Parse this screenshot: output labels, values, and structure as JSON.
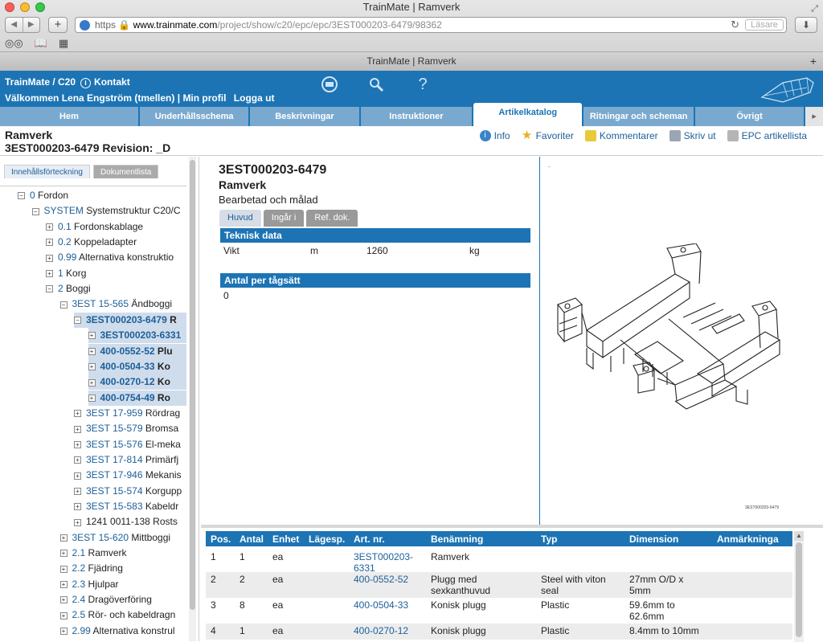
{
  "browser": {
    "title": "TrainMate | Ramverk",
    "url_scheme": "https",
    "url_host": "www.trainmate.com",
    "url_path": "/project/show/c20/epc/epc/3EST000203-6479/98362",
    "reader_label": "Läsare",
    "tab_title": "TrainMate | Ramverk"
  },
  "app": {
    "brand": "TrainMate / C20",
    "contact": "Kontakt",
    "welcome": "Välkommen Lena Engström (tmellen)",
    "profile": "Min profil",
    "logout": "Logga ut",
    "sep": "|"
  },
  "nav_tabs": [
    "Hem",
    "Underhållsschema",
    "Beskrivningar",
    "Instruktioner",
    "Artikelkatalog",
    "Ritningar och scheman",
    "Övrigt"
  ],
  "page": {
    "title": "Ramverk",
    "subtitle": "3EST000203-6479 Revision: _D",
    "actions": [
      "Info",
      "Favoriter",
      "Kommentarer",
      "Skriv ut",
      "EPC artikellista"
    ]
  },
  "left": {
    "tabs": [
      "Innehållsförteckning",
      "Dokumentlista"
    ],
    "tree": [
      {
        "code": "0",
        "name": "Fordon",
        "level": 0,
        "sign": "−"
      },
      {
        "code": "SYSTEM",
        "name": "Systemstruktur C20/C",
        "level": 1,
        "sign": "−"
      },
      {
        "code": "0.1",
        "name": "Fordonskablage",
        "level": 2,
        "sign": "+"
      },
      {
        "code": "0.2",
        "name": "Koppeladapter",
        "level": 2,
        "sign": "+"
      },
      {
        "code": "0.99",
        "name": "Alternativa konstruktio",
        "level": 2,
        "sign": "+"
      },
      {
        "code": "1",
        "name": "Korg",
        "level": 2,
        "sign": "+"
      },
      {
        "code": "2",
        "name": "Boggi",
        "level": 2,
        "sign": "−"
      },
      {
        "code": "3EST 15-565",
        "name": "Ändboggi",
        "level": 3,
        "sign": "−"
      },
      {
        "code": "3EST000203-6479",
        "name": "R",
        "level": 4,
        "sign": "−",
        "bold": true,
        "selected": true
      },
      {
        "code": "3EST000203-6331",
        "name": "",
        "level": 5,
        "sign": "+",
        "bold": true,
        "selected": true
      },
      {
        "code": "400-0552-52",
        "name": "Plu",
        "level": 5,
        "sign": "+",
        "bold": true,
        "selected": true
      },
      {
        "code": "400-0504-33",
        "name": "Ko",
        "level": 5,
        "sign": "+",
        "bold": true,
        "selected": true
      },
      {
        "code": "400-0270-12",
        "name": "Ko",
        "level": 5,
        "sign": "+",
        "bold": true,
        "selected": true
      },
      {
        "code": "400-0754-49",
        "name": "Ro",
        "level": 5,
        "sign": "+",
        "bold": true,
        "selected": true
      },
      {
        "code": "3EST 17-959",
        "name": "Rördrag",
        "level": 4,
        "sign": "+"
      },
      {
        "code": "3EST 15-579",
        "name": "Bromsa",
        "level": 4,
        "sign": "+"
      },
      {
        "code": "3EST 15-576",
        "name": "El-meka",
        "level": 4,
        "sign": "+"
      },
      {
        "code": "3EST 17-814",
        "name": "Primärfj",
        "level": 4,
        "sign": "+"
      },
      {
        "code": "3EST 17-946",
        "name": "Mekanis",
        "level": 4,
        "sign": "+"
      },
      {
        "code": "3EST 15-574",
        "name": "Korgupp",
        "level": 4,
        "sign": "+"
      },
      {
        "code": "3EST 15-583",
        "name": "Kabeldr",
        "level": 4,
        "sign": "+"
      },
      {
        "code": "",
        "name": "1241 0011-138 Rosts",
        "level": 4,
        "sign": "+"
      },
      {
        "code": "3EST 15-620",
        "name": "Mittboggi",
        "level": 3,
        "sign": "+"
      },
      {
        "code": "2.1",
        "name": "Ramverk",
        "level": 3,
        "sign": "+"
      },
      {
        "code": "2.2",
        "name": "Fjädring",
        "level": 3,
        "sign": "+"
      },
      {
        "code": "2.3",
        "name": "Hjulpar",
        "level": 3,
        "sign": "+"
      },
      {
        "code": "2.4",
        "name": "Dragöverföring",
        "level": 3,
        "sign": "+"
      },
      {
        "code": "2.5",
        "name": "Rör- och kabeldragn",
        "level": 3,
        "sign": "+"
      },
      {
        "code": "2.99",
        "name": "Alternativa konstrul",
        "level": 3,
        "sign": "+"
      }
    ]
  },
  "detail": {
    "article_no": "3EST000203-6479",
    "name": "Ramverk",
    "description": "Bearbetad och målad",
    "tabs": [
      "Huvud",
      "Ingår i",
      "Ref. dok."
    ],
    "tech_header": "Teknisk data",
    "tech": {
      "label": "Vikt",
      "unit_code": "m",
      "value": "1260",
      "unit": "kg"
    },
    "qty_header": "Antal per tågsätt",
    "qty_value": "0"
  },
  "image": {
    "dot": ".",
    "caption": "3EST000203-6479"
  },
  "parts_table": {
    "headers": [
      "Pos.",
      "Antal",
      "Enhet",
      "Lägesp.",
      "Art. nr.",
      "Benämning",
      "Typ",
      "Dimension",
      "Anmärkninga"
    ],
    "rows": [
      {
        "pos": "1",
        "antal": "1",
        "enhet": "ea",
        "art": [
          "3EST000203-",
          "6331"
        ],
        "ben": [
          "Ramverk"
        ],
        "typ": [
          ""
        ],
        "dim": [
          ""
        ]
      },
      {
        "pos": "2",
        "antal": "2",
        "enhet": "ea",
        "art": [
          "400-0552-52"
        ],
        "ben": [
          "Plugg med",
          "sexkanthuvud"
        ],
        "typ": [
          "Steel with viton",
          "seal"
        ],
        "dim": [
          "27mm O/D x",
          "5mm"
        ]
      },
      {
        "pos": "3",
        "antal": "8",
        "enhet": "ea",
        "art": [
          "400-0504-33"
        ],
        "ben": [
          "Konisk plugg"
        ],
        "typ": [
          "Plastic"
        ],
        "dim": [
          "59.6mm to",
          "62.6mm"
        ]
      },
      {
        "pos": "4",
        "antal": "1",
        "enhet": "ea",
        "art": [
          "400-0270-12"
        ],
        "ben": [
          "Konisk plugg"
        ],
        "typ": [
          "Plastic"
        ],
        "dim": [
          "8.4mm to 10mm"
        ]
      }
    ]
  }
}
